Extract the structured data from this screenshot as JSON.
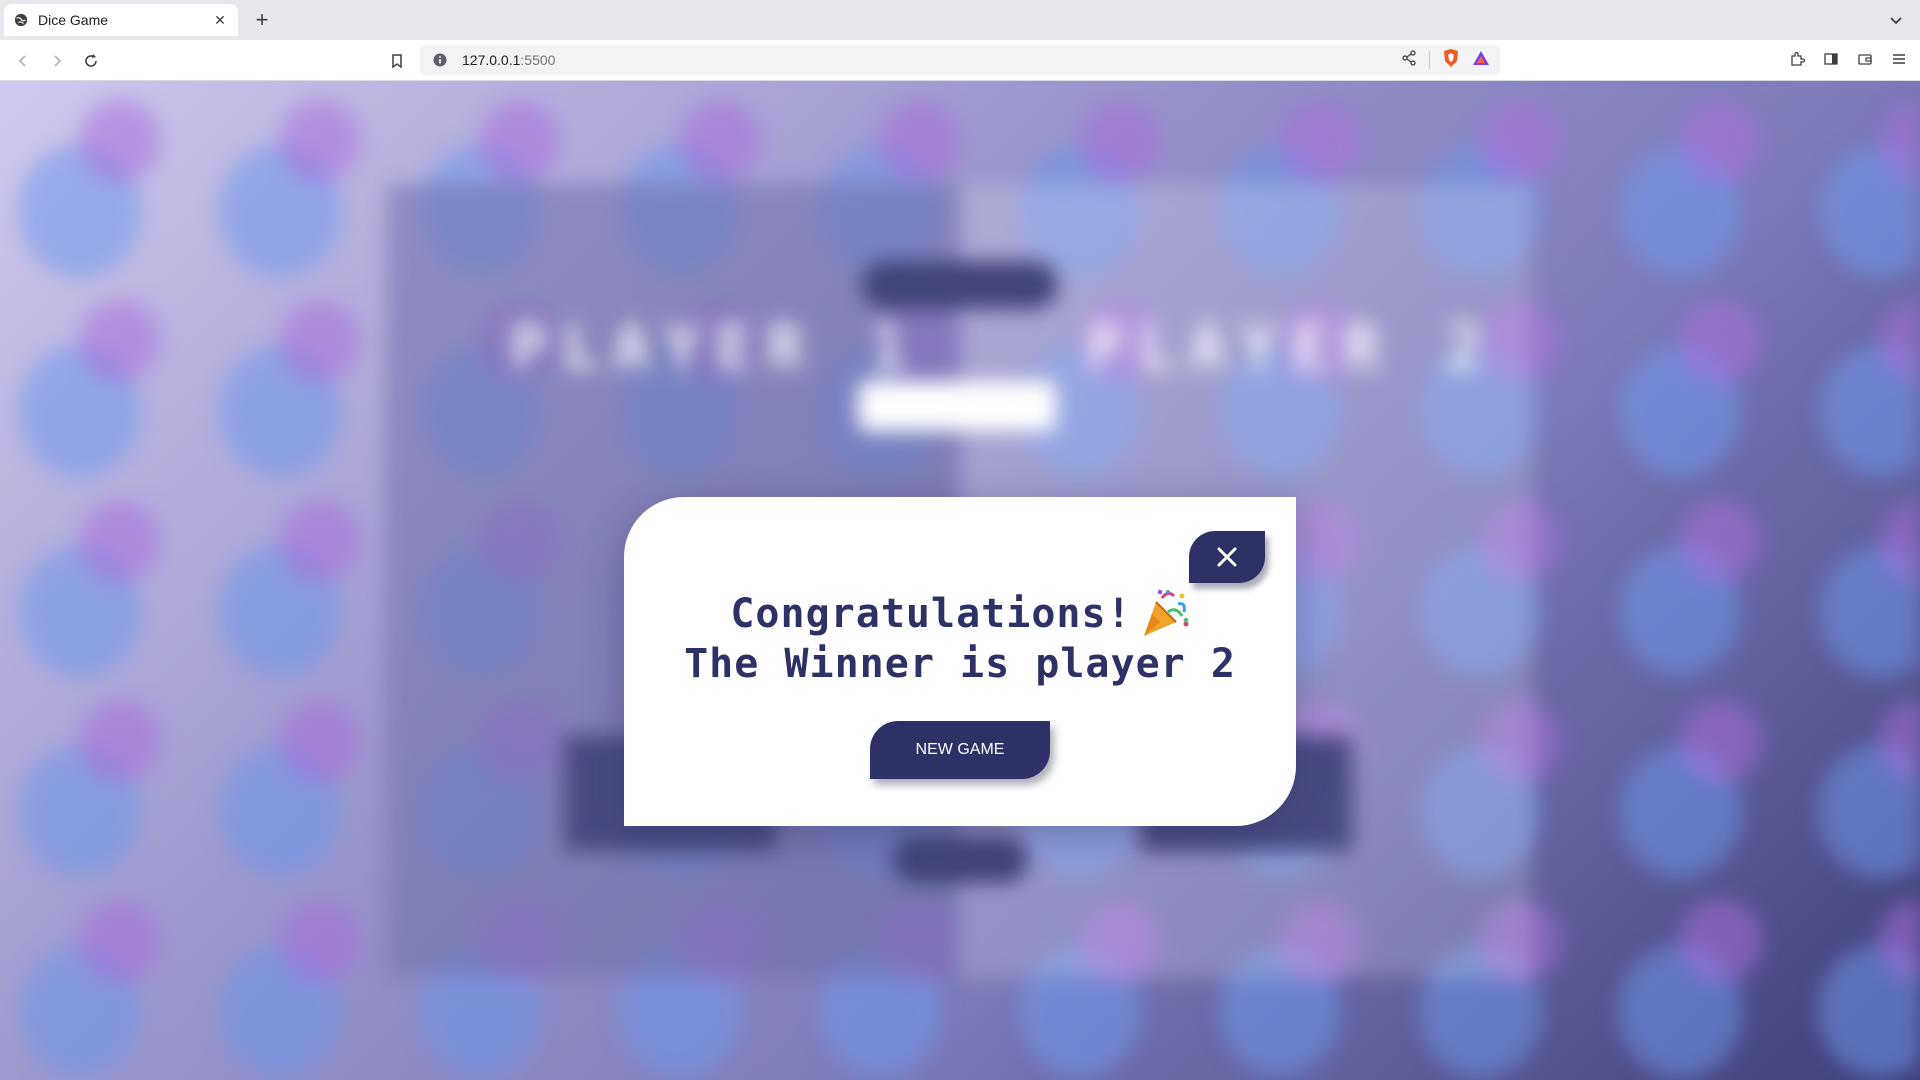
{
  "browser": {
    "tab_title": "Dice Game",
    "url_host": "127.0.0.1",
    "url_port": ":5500"
  },
  "game": {
    "player1_name": "PLAYER 1",
    "player2_name": "PLAYER 2"
  },
  "modal": {
    "congrats": "Congratulations!",
    "winner_text": "The Winner is player 2",
    "new_game_label": "NEW GAME",
    "close_symbol": "✕"
  },
  "colors": {
    "accent": "#2e3166",
    "modal_bg": "#ffffff"
  }
}
